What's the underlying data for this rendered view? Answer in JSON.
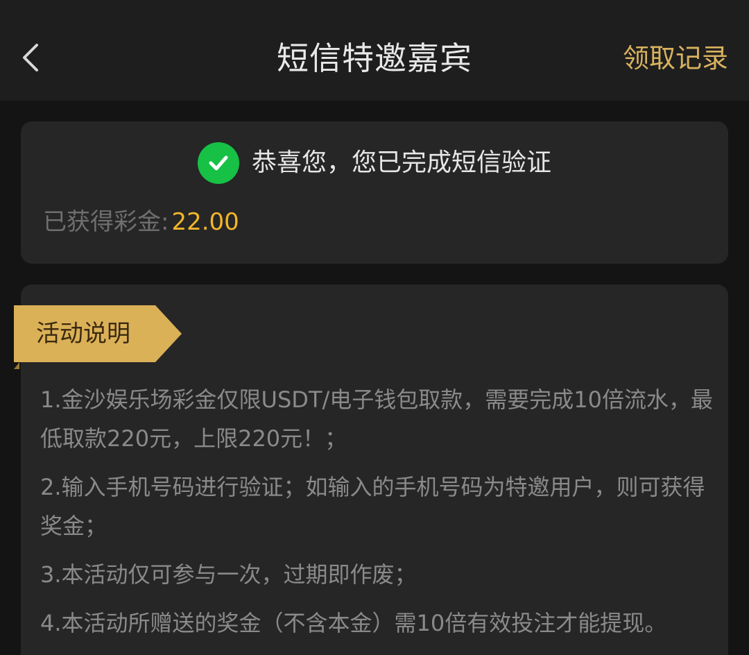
{
  "header": {
    "title": "短信特邀嘉宾",
    "records_label": "领取记录",
    "back_icon": "chevron-left-icon"
  },
  "status": {
    "icon": "check-circle-icon",
    "message": "恭喜您，您已完成短信验证",
    "bonus_label": "已获得彩金:",
    "bonus_value": "22.00"
  },
  "info": {
    "section_title": "活动说明",
    "rules": [
      "1.金沙娱乐场彩金仅限USDT/电子钱包取款，需要完成10倍流水，最低取款220元，上限220元！；",
      "2.输入手机号码进行验证；如输入的手机号码为特邀用户，则可获得奖金；",
      "3.本活动仅可参与一次，过期即作废；",
      "4.本活动所赠送的奖金（不含本金）需10倍有效投注才能提现。"
    ]
  },
  "colors": {
    "background": "#141414",
    "header": "#1e1e1e",
    "card": "#262626",
    "gold": "#d8b25e",
    "bonus": "#f3b629",
    "success": "#17c145"
  }
}
